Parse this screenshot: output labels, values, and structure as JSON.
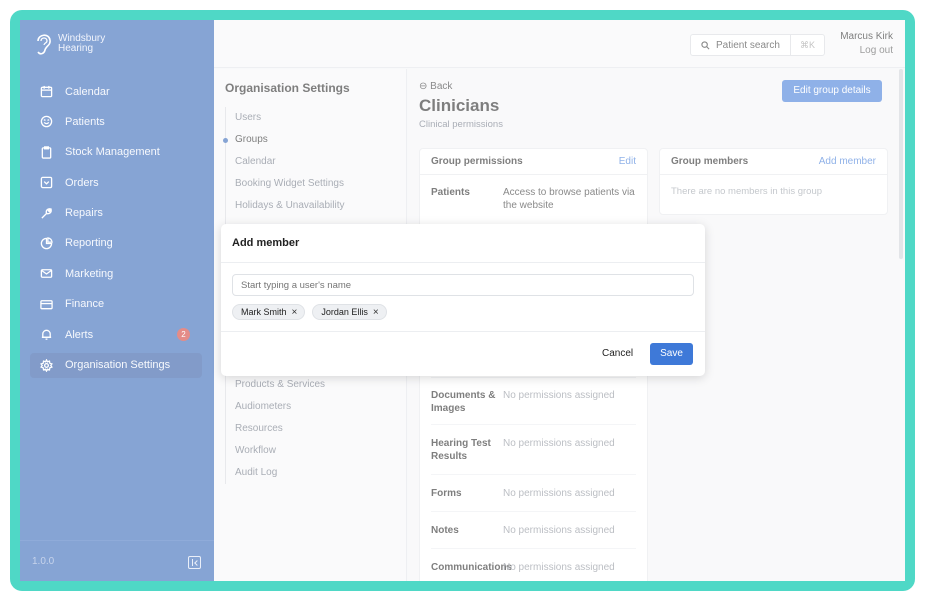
{
  "brand": {
    "line1": "Windsbury",
    "line2": "Hearing"
  },
  "sidebar": {
    "items": [
      {
        "label": "Calendar",
        "icon": "calendar-icon"
      },
      {
        "label": "Patients",
        "icon": "smile-icon"
      },
      {
        "label": "Stock Management",
        "icon": "clipboard-icon"
      },
      {
        "label": "Orders",
        "icon": "inbox-icon"
      },
      {
        "label": "Repairs",
        "icon": "wrench-icon"
      },
      {
        "label": "Reporting",
        "icon": "pie-chart-icon"
      },
      {
        "label": "Marketing",
        "icon": "mail-icon"
      },
      {
        "label": "Finance",
        "icon": "credit-card-icon"
      },
      {
        "label": "Alerts",
        "icon": "bell-icon",
        "badge": "2"
      },
      {
        "label": "Organisation Settings",
        "icon": "gear-icon",
        "active": true
      }
    ],
    "version": "1.0.0"
  },
  "topbar": {
    "search_label": "Patient search",
    "search_shortcut": "⌘K",
    "user_name": "Marcus Kirk",
    "logout_label": "Log out"
  },
  "settings": {
    "title": "Organisation Settings",
    "nav_top": [
      "Users",
      "Groups",
      "Calendar",
      "Booking Widget Settings",
      "Holidays & Unavailability"
    ],
    "nav_bottom": [
      "Products & Services",
      "Audiometers",
      "Resources",
      "Workflow",
      "Audit Log"
    ],
    "active": "Groups"
  },
  "group": {
    "back_label": "Back",
    "title": "Clinicians",
    "subtitle": "Clinical permissions",
    "edit_details_label": "Edit group details"
  },
  "permissions_card": {
    "title": "Group permissions",
    "edit_label": "Edit",
    "rows": [
      {
        "name": "Patients",
        "value": "Access to browse patients via the website"
      },
      {
        "name": "Documents & Images",
        "value": "No permissions assigned"
      },
      {
        "name": "Hearing Test Results",
        "value": "No permissions assigned"
      },
      {
        "name": "Forms",
        "value": "No permissions assigned"
      },
      {
        "name": "Notes",
        "value": "No permissions assigned"
      },
      {
        "name": "Communications",
        "value": "No permissions assigned"
      }
    ]
  },
  "members_card": {
    "title": "Group members",
    "add_label": "Add member",
    "empty_text": "There are no members in this group"
  },
  "modal": {
    "title": "Add member",
    "input_placeholder": "Start typing a user's name",
    "chips": [
      "Mark Smith",
      "Jordan Ellis"
    ],
    "cancel_label": "Cancel",
    "save_label": "Save"
  },
  "colors": {
    "sidebar": "#2f62b5",
    "accent": "#3e79d8",
    "frame": "#4fd8c6",
    "badge": "#d13a32"
  }
}
